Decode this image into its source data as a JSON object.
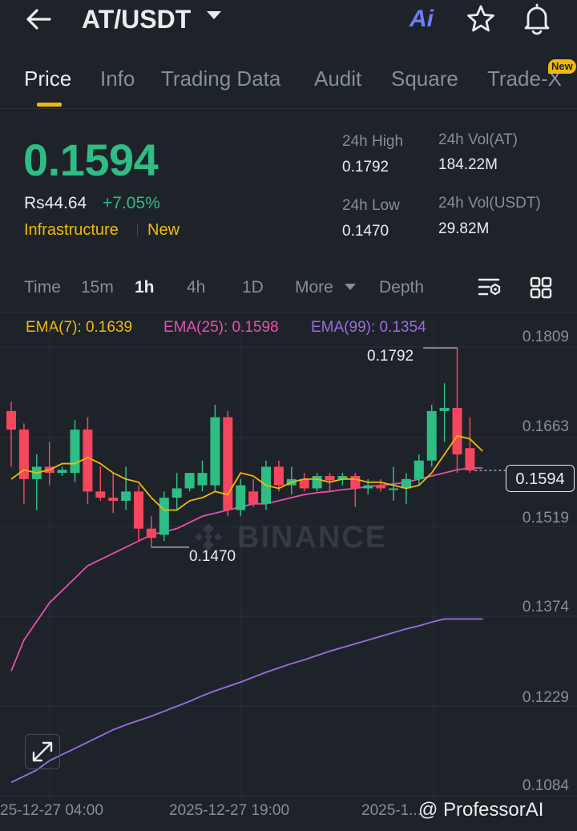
{
  "header": {
    "pair": "AT/USDT",
    "ai_label": "Ai"
  },
  "tabs": [
    {
      "label": "Price",
      "active": true
    },
    {
      "label": "Info"
    },
    {
      "label": "Trading Data"
    },
    {
      "label": "Audit"
    },
    {
      "label": "Square"
    },
    {
      "label": "Trade-X",
      "badge": "New"
    }
  ],
  "price": {
    "last": "0.1594",
    "fiat": "Rs44.64",
    "change": "+7.05%",
    "tags": [
      "Infrastructure",
      "New"
    ]
  },
  "stats": {
    "high_label": "24h High",
    "high_value": "0.1792",
    "low_label": "24h Low",
    "low_value": "0.1470",
    "vol_base_label": "24h Vol(AT)",
    "vol_base_value": "184.22M",
    "vol_quote_label": "24h Vol(USDT)",
    "vol_quote_value": "29.82M"
  },
  "intervals": {
    "time": "Time",
    "m15": "15m",
    "h1": "1h",
    "h4": "4h",
    "d1": "1D",
    "more": "More",
    "depth": "Depth",
    "active": "1h"
  },
  "ema": {
    "ema7": "EMA(7): 0.1639",
    "ema25": "EMA(25): 0.1598",
    "ema99": "EMA(99): 0.1354"
  },
  "colors": {
    "up": "#2ebd85",
    "down": "#f6465d",
    "accent": "#f0b90b",
    "ema7": "#f0b90b",
    "ema25": "#e84fb0",
    "ema99": "#9b6ee0"
  },
  "icons": {
    "back": "arrow-left-icon",
    "caret": "caret-down-icon",
    "star": "star-icon",
    "bell": "bell-icon",
    "settings": "chart-settings-icon",
    "grid": "grid-icon",
    "expand": "expand-icon"
  },
  "chart_data": {
    "type": "candlestick",
    "y_ticks": [
      "0.1809",
      "0.1663",
      "0.1519",
      "0.1374",
      "0.1229",
      "0.1084"
    ],
    "x_ticks": [
      "25-12-27 04:00",
      "2025-12-27 19:00",
      "2025-1..."
    ],
    "ylim": [
      0.1084,
      0.1809
    ],
    "current_price": "0.1594",
    "high_marker": "0.1792",
    "low_marker": "0.1470",
    "watermark": "BINANCE",
    "credit": "@ ProfessorAI",
    "candles": [
      {
        "o": 0.169,
        "h": 0.1705,
        "c": 0.166,
        "l": 0.16
      },
      {
        "o": 0.166,
        "h": 0.167,
        "c": 0.158,
        "l": 0.154
      },
      {
        "o": 0.158,
        "h": 0.162,
        "c": 0.16,
        "l": 0.153
      },
      {
        "o": 0.16,
        "h": 0.164,
        "c": 0.159,
        "l": 0.157
      },
      {
        "o": 0.159,
        "h": 0.16,
        "c": 0.1595,
        "l": 0.1585
      },
      {
        "o": 0.159,
        "h": 0.1675,
        "c": 0.166,
        "l": 0.1575
      },
      {
        "o": 0.166,
        "h": 0.168,
        "c": 0.156,
        "l": 0.154
      },
      {
        "o": 0.156,
        "h": 0.16,
        "c": 0.155,
        "l": 0.1545
      },
      {
        "o": 0.155,
        "h": 0.159,
        "c": 0.1545,
        "l": 0.1525
      },
      {
        "o": 0.1545,
        "h": 0.16,
        "c": 0.156,
        "l": 0.153
      },
      {
        "o": 0.156,
        "h": 0.157,
        "c": 0.15,
        "l": 0.148
      },
      {
        "o": 0.15,
        "h": 0.152,
        "c": 0.1485,
        "l": 0.147
      },
      {
        "o": 0.149,
        "h": 0.156,
        "c": 0.155,
        "l": 0.148
      },
      {
        "o": 0.155,
        "h": 0.159,
        "c": 0.1565,
        "l": 0.153
      },
      {
        "o": 0.1565,
        "h": 0.159,
        "c": 0.159,
        "l": 0.156
      },
      {
        "o": 0.157,
        "h": 0.161,
        "c": 0.159,
        "l": 0.156
      },
      {
        "o": 0.157,
        "h": 0.17,
        "c": 0.168,
        "l": 0.156
      },
      {
        "o": 0.168,
        "h": 0.169,
        "c": 0.153,
        "l": 0.152
      },
      {
        "o": 0.153,
        "h": 0.158,
        "c": 0.157,
        "l": 0.152
      },
      {
        "o": 0.156,
        "h": 0.158,
        "c": 0.154,
        "l": 0.1535
      },
      {
        "o": 0.154,
        "h": 0.161,
        "c": 0.16,
        "l": 0.153
      },
      {
        "o": 0.16,
        "h": 0.161,
        "c": 0.157,
        "l": 0.156
      },
      {
        "o": 0.157,
        "h": 0.16,
        "c": 0.158,
        "l": 0.1555
      },
      {
        "o": 0.158,
        "h": 0.159,
        "c": 0.1565,
        "l": 0.156
      },
      {
        "o": 0.1565,
        "h": 0.159,
        "c": 0.1585,
        "l": 0.156
      },
      {
        "o": 0.1585,
        "h": 0.159,
        "c": 0.1578,
        "l": 0.156
      },
      {
        "o": 0.158,
        "h": 0.159,
        "c": 0.1585,
        "l": 0.157
      },
      {
        "o": 0.1585,
        "h": 0.159,
        "c": 0.1565,
        "l": 0.1535
      },
      {
        "o": 0.1565,
        "h": 0.158,
        "c": 0.157,
        "l": 0.1555
      },
      {
        "o": 0.157,
        "h": 0.158,
        "c": 0.1565,
        "l": 0.156
      },
      {
        "o": 0.1565,
        "h": 0.16,
        "c": 0.1565,
        "l": 0.1545
      },
      {
        "o": 0.1565,
        "h": 0.159,
        "c": 0.158,
        "l": 0.154
      },
      {
        "o": 0.158,
        "h": 0.162,
        "c": 0.161,
        "l": 0.157
      },
      {
        "o": 0.161,
        "h": 0.17,
        "c": 0.169,
        "l": 0.16
      },
      {
        "o": 0.169,
        "h": 0.1735,
        "c": 0.1695,
        "l": 0.164
      },
      {
        "o": 0.1695,
        "h": 0.1792,
        "c": 0.162,
        "l": 0.159
      },
      {
        "o": 0.163,
        "h": 0.168,
        "c": 0.1594,
        "l": 0.159
      }
    ],
    "ema7": [
      0.158,
      0.1595,
      0.159,
      0.1595,
      0.1605,
      0.1605,
      0.1615,
      0.1605,
      0.159,
      0.158,
      0.1575,
      0.155,
      0.153,
      0.153,
      0.1545,
      0.155,
      0.156,
      0.1555,
      0.159,
      0.1585,
      0.157,
      0.1565,
      0.1575,
      0.158,
      0.158,
      0.1575,
      0.158,
      0.158,
      0.1575,
      0.1575,
      0.157,
      0.1565,
      0.157,
      0.159,
      0.162,
      0.165,
      0.1645,
      0.1625
    ],
    "ema25": [
      0.127,
      0.132,
      0.135,
      0.138,
      0.14,
      0.142,
      0.144,
      0.145,
      0.146,
      0.147,
      0.148,
      0.149,
      0.1495,
      0.15,
      0.151,
      0.152,
      0.1525,
      0.153,
      0.1535,
      0.154,
      0.154,
      0.1545,
      0.155,
      0.1555,
      0.1558,
      0.156,
      0.1563,
      0.1565,
      0.1568,
      0.157,
      0.1572,
      0.1575,
      0.158,
      0.1585,
      0.159,
      0.1595,
      0.1598,
      0.1598
    ],
    "ema99": [
      0.109,
      0.11,
      0.111,
      0.1125,
      0.1135,
      0.1145,
      0.1155,
      0.1165,
      0.1175,
      0.1183,
      0.119,
      0.1197,
      0.1205,
      0.1213,
      0.1221,
      0.123,
      0.1238,
      0.1245,
      0.1252,
      0.126,
      0.1268,
      0.1275,
      0.1282,
      0.1288,
      0.1295,
      0.1302,
      0.1308,
      0.1314,
      0.132,
      0.1326,
      0.1332,
      0.1338,
      0.1343,
      0.1349,
      0.1354,
      0.1354,
      0.1354,
      0.1354
    ]
  }
}
